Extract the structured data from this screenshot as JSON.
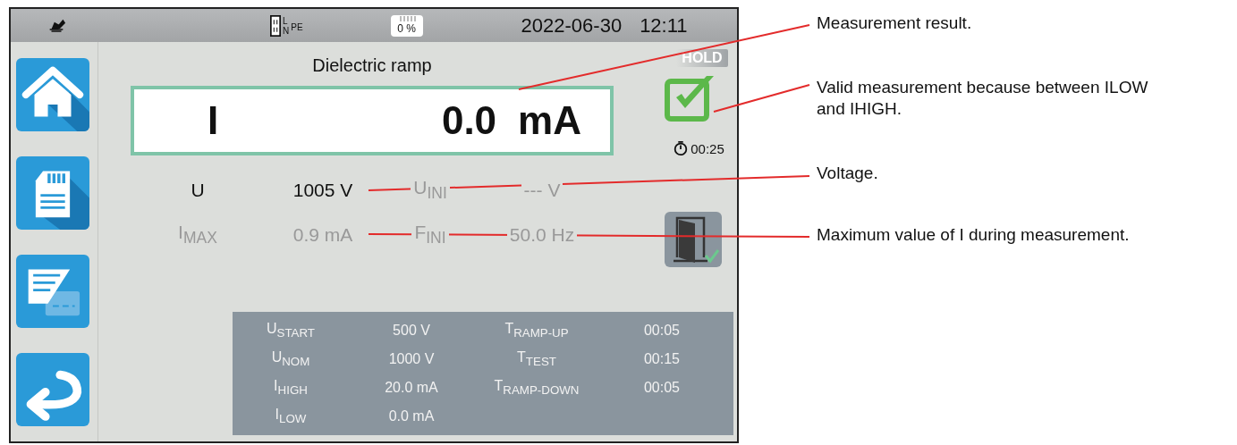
{
  "status_bar": {
    "line_label": "L",
    "neutral_label": "N",
    "earth_label": "PE",
    "storage": "0 %",
    "date": "2022-06-30",
    "time": "12:11"
  },
  "sidebar": {
    "buttons": [
      {
        "kind": "home"
      },
      {
        "kind": "memory"
      },
      {
        "kind": "report"
      },
      {
        "kind": "back"
      }
    ]
  },
  "measurement": {
    "title": "Dielectric ramp",
    "hold": "HOLD",
    "quantity": "I",
    "value": "0.0",
    "unit": "mA",
    "valid": true,
    "timer": "00:25"
  },
  "readings": [
    {
      "label": "U",
      "value": "1005 V",
      "dimmed": false
    },
    {
      "label": "U$_{INI}$",
      "value": "--- V",
      "dimmed": true
    },
    {
      "label": "I$_{MAX}$",
      "value": "0.9 mA",
      "dimmed": true
    },
    {
      "label": "F$_{INI}$",
      "value": "50.0 Hz",
      "dimmed": true
    }
  ],
  "parameters": [
    {
      "label": "U$_{START}$",
      "value": "500 V"
    },
    {
      "label": "T$_{RAMP-UP}$",
      "value": "00:05"
    },
    {
      "label": "U$_{NOM}$",
      "value": "1000 V"
    },
    {
      "label": "T$_{TEST}$",
      "value": "00:15"
    },
    {
      "label": "I$_{HIGH}$",
      "value": "20.0 mA"
    },
    {
      "label": "T$_{RAMP-DOWN}$",
      "value": "00:05"
    },
    {
      "label": "I$_{LOW}$",
      "value": "0.0 mA"
    }
  ],
  "annotations": [
    "Measurement result.",
    "Valid measurement because between ILOW and IHIGH.",
    "Voltage.",
    "Maximum value of I during measurement."
  ]
}
